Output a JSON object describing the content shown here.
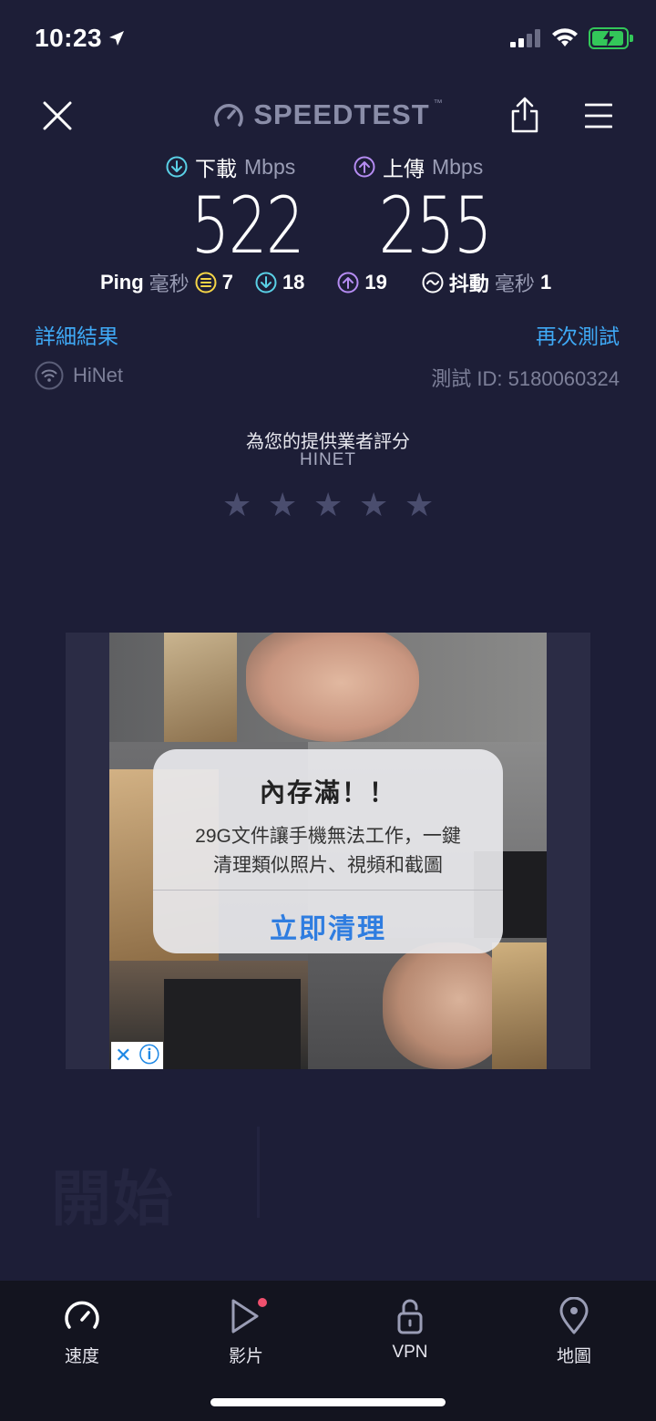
{
  "status_bar": {
    "time": "10:23"
  },
  "header": {
    "logo_text": "SPEEDTEST",
    "logo_tm": "™"
  },
  "download": {
    "label": "下載",
    "unit": "Mbps",
    "value": "522"
  },
  "upload": {
    "label": "上傳",
    "unit": "Mbps",
    "value": "255"
  },
  "ping": {
    "label": "Ping",
    "unit": "毫秒",
    "idle": "7",
    "download": "18",
    "upload": "19",
    "jitter_label": "抖動",
    "jitter_unit": "毫秒",
    "jitter": "1"
  },
  "links": {
    "details": "詳細結果",
    "retest": "再次測試"
  },
  "provider": {
    "name": "HiNet",
    "test_id": "測試 ID: 5180060324"
  },
  "rating": {
    "title": "為您的提供業者評分",
    "provider": "HINET",
    "stars": 5,
    "rating_value": 0
  },
  "ad": {
    "title": "內存滿！！",
    "body_line1": "29G文件讓手機無法工作，一鍵",
    "body_line2": "清理類似照片、視頻和截圖",
    "button": "立即清理",
    "close": "✕",
    "info": "ⓘ"
  },
  "background": {
    "go_text": "開始"
  },
  "tabs": [
    {
      "label": "速度",
      "icon": "speedometer-icon"
    },
    {
      "label": "影片",
      "icon": "play-icon"
    },
    {
      "label": "VPN",
      "icon": "lock-icon"
    },
    {
      "label": "地圖",
      "icon": "map-pin-icon"
    }
  ],
  "colors": {
    "background": "#1d1e37",
    "accent_link": "#3fa9f5",
    "download": "#5ad0e6",
    "upload": "#b58cf2",
    "idle": "#f5d547"
  }
}
